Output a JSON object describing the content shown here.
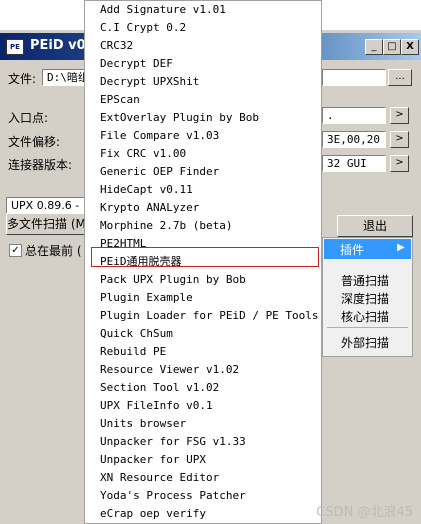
{
  "window": {
    "title": "PEiD v0",
    "icon_text": "PE",
    "min_glyph": "_",
    "max_glyph": "□",
    "close_glyph": "X"
  },
  "fields": {
    "file_label": "文件:",
    "file_value": "D:\\暗组",
    "browse_label": "...",
    "entry_label": "入口点:",
    "offset_label": "文件偏移:",
    "linker_label": "连接器版本:",
    "entry_tail": ".",
    "offset_tail": "3E,00,20",
    "linker_tail": "32 GUI",
    "arrow_glyph": ">"
  },
  "status": {
    "text": "UPX 0.89.6 -"
  },
  "buttons": {
    "multi_scan": "多文件扫描 (M",
    "exit": "退出"
  },
  "options": {
    "always_on_top": "总在最前 (",
    "always_on_top_checked": "✓"
  },
  "plugin_menu": {
    "items": [
      "Add Signature v1.01",
      "C.I Crypt 0.2",
      "CRC32",
      "Decrypt DEF",
      "Decrypt UPXShit",
      "EPScan",
      "ExtOverlay Plugin by Bob",
      "File Compare v1.03",
      "Fix CRC v1.00",
      "Generic OEP Finder",
      "HideCapt v0.11",
      "Krypto ANALyzer",
      "Morphine 2.7b (beta)",
      "PE2HTML",
      "PEiD通用脱壳器",
      "Pack UPX Plugin by Bob",
      "Plugin Example",
      "Plugin Loader for PEiD / PE Tools",
      "Quick ChSum",
      "Rebuild PE",
      "Resource Viewer v1.02",
      "Section Tool v1.02",
      "UPX FileInfo v0.1",
      "Units browser",
      "Unpacker for FSG v1.33",
      "Unpacker for UPX",
      "XN Resource Editor",
      "Yoda's Process Patcher",
      "eCrap oep verify"
    ],
    "highlighted_item": "PEiD通用脱壳器"
  },
  "context_menu": {
    "plugins": "插件",
    "plugins_arrow": "▶",
    "normal_scan": "普通扫描",
    "deep_scan": "深度扫描",
    "core_scan": "核心扫描",
    "external_scan": "外部扫描"
  },
  "watermark": "CSDN @北浪45",
  "colors": {
    "highlight_border": "#cc2222",
    "menu_selection": "#3399ff",
    "titlebar": "#0a246a"
  }
}
